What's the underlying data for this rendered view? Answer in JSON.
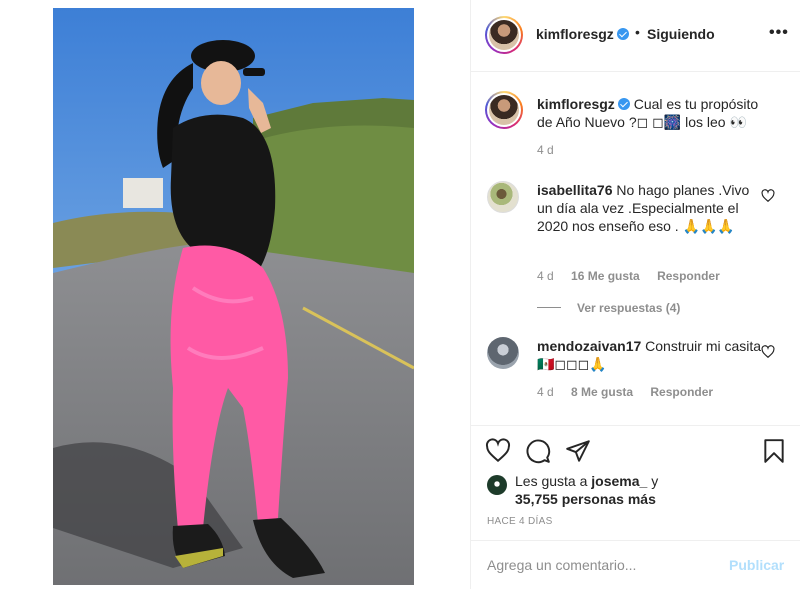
{
  "post": {
    "username": "kimfloresgz",
    "follow_dot": "•",
    "follow_label": "Siguiendo",
    "more_label": "•••"
  },
  "caption": {
    "username": "kimfloresgz",
    "text": "Cual es tu propósito de Año Nuevo ?◻ ◻🎆 los leo 👀",
    "time": "4 d"
  },
  "comments": [
    {
      "username": "isabellita76",
      "text": "No hago planes .Vivo un día ala vez .Especialmente el 2020 nos enseño eso . 🙏🙏🙏",
      "time": "4 d",
      "likes": "16 Me gusta",
      "reply": "Responder",
      "view_replies": "Ver respuestas (4)"
    },
    {
      "username": "mendozaivan17",
      "text": "Construir mi casita 🇲🇽◻◻◻🙏",
      "time": "4 d",
      "likes": "8 Me gusta",
      "reply": "Responder"
    }
  ],
  "likes": {
    "prefix": "Les gusta a",
    "user": "josema_",
    "connector": "y",
    "others": "35,755 personas más"
  },
  "time_ago": "HACE 4 DÍAS",
  "comment_box": {
    "placeholder": "Agrega un comentario...",
    "post_label": "Publicar"
  },
  "colors": {
    "verified": "#3897f0",
    "muted": "#8e8e8e",
    "post_disabled": "#b2dffc",
    "leggings": "#ff5aa5"
  },
  "icons": [
    "heart-icon",
    "comment-icon",
    "share-icon",
    "bookmark-icon",
    "verified-icon",
    "more-icon"
  ]
}
